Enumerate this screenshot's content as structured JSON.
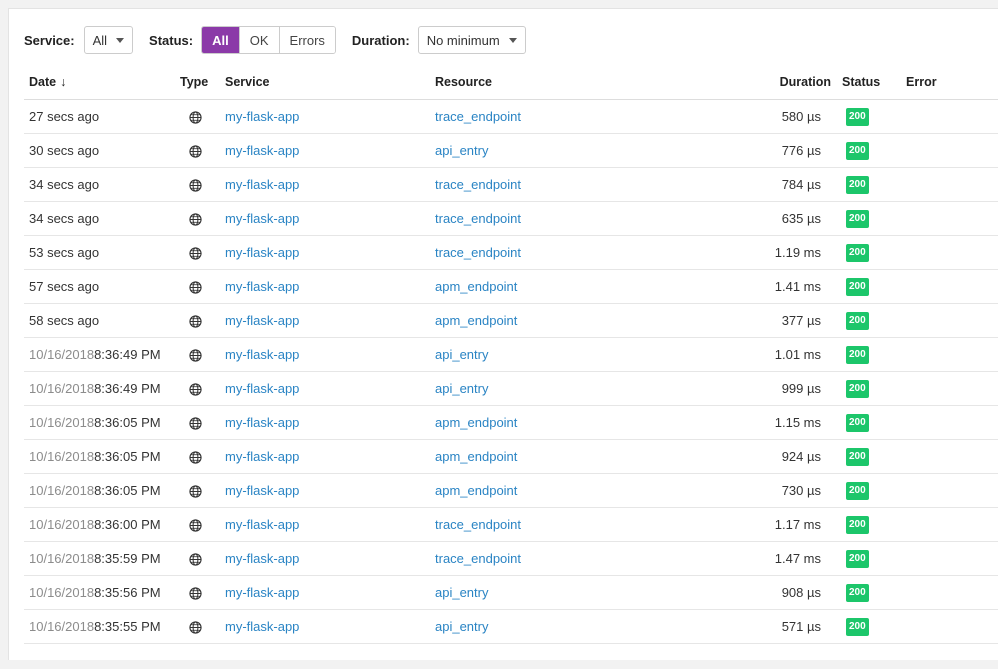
{
  "filters": {
    "service_label": "Service:",
    "service_value": "All",
    "status_label": "Status:",
    "status_options": [
      "All",
      "OK",
      "Errors"
    ],
    "status_selected": "All",
    "duration_label": "Duration:",
    "duration_value": "No minimum"
  },
  "table": {
    "columns": {
      "date": "Date",
      "date_sort": "↓",
      "type": "Type",
      "service": "Service",
      "resource": "Resource",
      "duration": "Duration",
      "status": "Status",
      "error": "Error"
    },
    "type_icon": "globe-icon",
    "badge_color": "#1cc66a",
    "rows": [
      {
        "date_prefix": "",
        "date": "27 secs ago",
        "service": "my-flask-app",
        "resource": "trace_endpoint",
        "duration": "580 µs",
        "status": "200",
        "error": ""
      },
      {
        "date_prefix": "",
        "date": "30 secs ago",
        "service": "my-flask-app",
        "resource": "api_entry",
        "duration": "776 µs",
        "status": "200",
        "error": ""
      },
      {
        "date_prefix": "",
        "date": "34 secs ago",
        "service": "my-flask-app",
        "resource": "trace_endpoint",
        "duration": "784 µs",
        "status": "200",
        "error": ""
      },
      {
        "date_prefix": "",
        "date": "34 secs ago",
        "service": "my-flask-app",
        "resource": "trace_endpoint",
        "duration": "635 µs",
        "status": "200",
        "error": ""
      },
      {
        "date_prefix": "",
        "date": "53 secs ago",
        "service": "my-flask-app",
        "resource": "trace_endpoint",
        "duration": "1.19 ms",
        "status": "200",
        "error": ""
      },
      {
        "date_prefix": "",
        "date": "57 secs ago",
        "service": "my-flask-app",
        "resource": "apm_endpoint",
        "duration": "1.41 ms",
        "status": "200",
        "error": ""
      },
      {
        "date_prefix": "",
        "date": "58 secs ago",
        "service": "my-flask-app",
        "resource": "apm_endpoint",
        "duration": "377 µs",
        "status": "200",
        "error": ""
      },
      {
        "date_prefix": "10/16/2018",
        "date": "8:36:49 PM",
        "service": "my-flask-app",
        "resource": "api_entry",
        "duration": "1.01 ms",
        "status": "200",
        "error": ""
      },
      {
        "date_prefix": "10/16/2018",
        "date": "8:36:49 PM",
        "service": "my-flask-app",
        "resource": "api_entry",
        "duration": "999 µs",
        "status": "200",
        "error": ""
      },
      {
        "date_prefix": "10/16/2018",
        "date": "8:36:05 PM",
        "service": "my-flask-app",
        "resource": "apm_endpoint",
        "duration": "1.15 ms",
        "status": "200",
        "error": ""
      },
      {
        "date_prefix": "10/16/2018",
        "date": "8:36:05 PM",
        "service": "my-flask-app",
        "resource": "apm_endpoint",
        "duration": "924 µs",
        "status": "200",
        "error": ""
      },
      {
        "date_prefix": "10/16/2018",
        "date": "8:36:05 PM",
        "service": "my-flask-app",
        "resource": "apm_endpoint",
        "duration": "730 µs",
        "status": "200",
        "error": ""
      },
      {
        "date_prefix": "10/16/2018",
        "date": "8:36:00 PM",
        "service": "my-flask-app",
        "resource": "trace_endpoint",
        "duration": "1.17 ms",
        "status": "200",
        "error": ""
      },
      {
        "date_prefix": "10/16/2018",
        "date": "8:35:59 PM",
        "service": "my-flask-app",
        "resource": "trace_endpoint",
        "duration": "1.47 ms",
        "status": "200",
        "error": ""
      },
      {
        "date_prefix": "10/16/2018",
        "date": "8:35:56 PM",
        "service": "my-flask-app",
        "resource": "api_entry",
        "duration": "908 µs",
        "status": "200",
        "error": ""
      },
      {
        "date_prefix": "10/16/2018",
        "date": "8:35:55 PM",
        "service": "my-flask-app",
        "resource": "api_entry",
        "duration": "571 µs",
        "status": "200",
        "error": ""
      }
    ]
  }
}
